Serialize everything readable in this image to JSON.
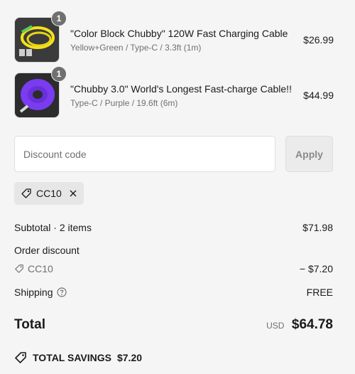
{
  "items": [
    {
      "quantity": "1",
      "title": "\"Color Block Chubby\" 120W Fast Charging Cable",
      "variant": "Yellow+Green / Type-C / 3.3ft (1m)",
      "price": "$26.99"
    },
    {
      "quantity": "1",
      "title": "\"Chubby 3.0\" World's Longest Fast-charge Cable!!",
      "variant": "Type-C / Purple / 19.6ft (6m)",
      "price": "$44.99"
    }
  ],
  "discount": {
    "placeholder": "Discount code",
    "apply_label": "Apply",
    "applied_code": "CC10"
  },
  "summary": {
    "subtotal_label": "Subtotal · 2 items",
    "subtotal_value": "$71.98",
    "order_discount_label": "Order discount",
    "discount_code": "CC10",
    "discount_value": "− $7.20",
    "shipping_label": "Shipping",
    "shipping_value": "FREE",
    "total_label": "Total",
    "currency": "USD",
    "total_value": "$64.78",
    "savings_label": "TOTAL SAVINGS",
    "savings_value": "$7.20"
  },
  "colors": {
    "background": "#f5f5f5",
    "muted_text": "#707070",
    "badge": "#707070",
    "cable_yellow": "#f2e21a",
    "cable_purple": "#7a3cf0"
  }
}
